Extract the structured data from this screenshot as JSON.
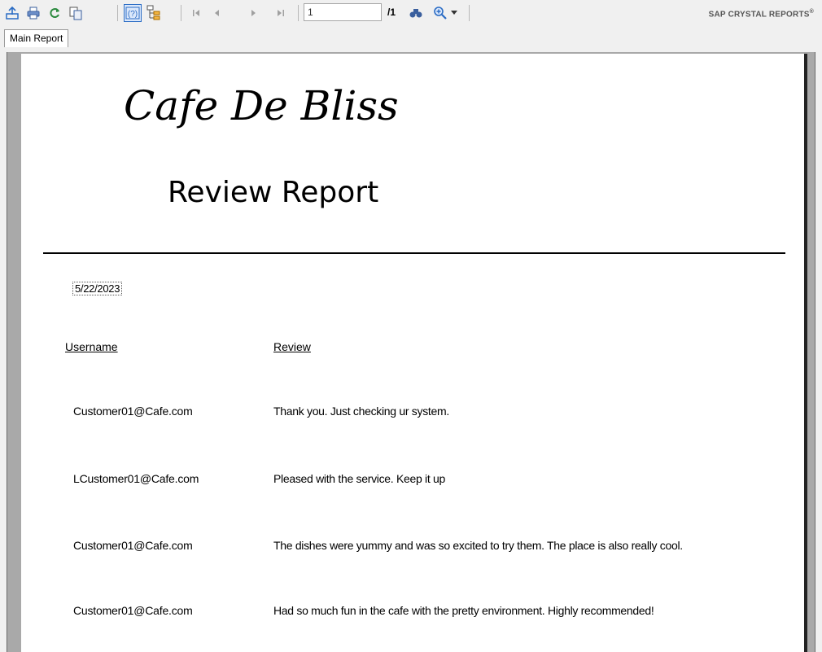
{
  "toolbar": {
    "page_current": "1",
    "page_total": "/1",
    "brand": "SAP CRYSTAL REPORTS",
    "brand_mark": "®",
    "icons": [
      "export-icon",
      "print-icon",
      "refresh-icon",
      "copy-icon",
      "help-icon",
      "group-tree-icon",
      "first-page-icon",
      "prev-page-icon",
      "next-page-icon",
      "last-page-icon",
      "find-icon",
      "zoom-icon",
      "dropdown-arrow-icon"
    ]
  },
  "tabs": [
    {
      "label": "Main Report"
    }
  ],
  "report": {
    "title": "Cafe De Bliss",
    "subtitle": "Review Report",
    "date": "5/22/2023",
    "headers": {
      "username": "Username",
      "review": "Review"
    },
    "rows": [
      {
        "username": "Customer01@Cafe.com",
        "review": "Thank you. Just checking ur system."
      },
      {
        "username": "LCustomer01@Cafe.com",
        "review": "Pleased with the service. Keep it up"
      },
      {
        "username": "Customer01@Cafe.com",
        "review": "The dishes were yummy and was so excited to try them.  The place is also really cool."
      },
      {
        "username": "Customer01@Cafe.com",
        "review": "Had so much fun in the cafe with the pretty environment. Highly recommended!"
      }
    ]
  },
  "colors": {
    "accent_blue": "#2b6cc4",
    "page_bg": "#ffffff",
    "frame_bg": "#a9a9a9"
  }
}
